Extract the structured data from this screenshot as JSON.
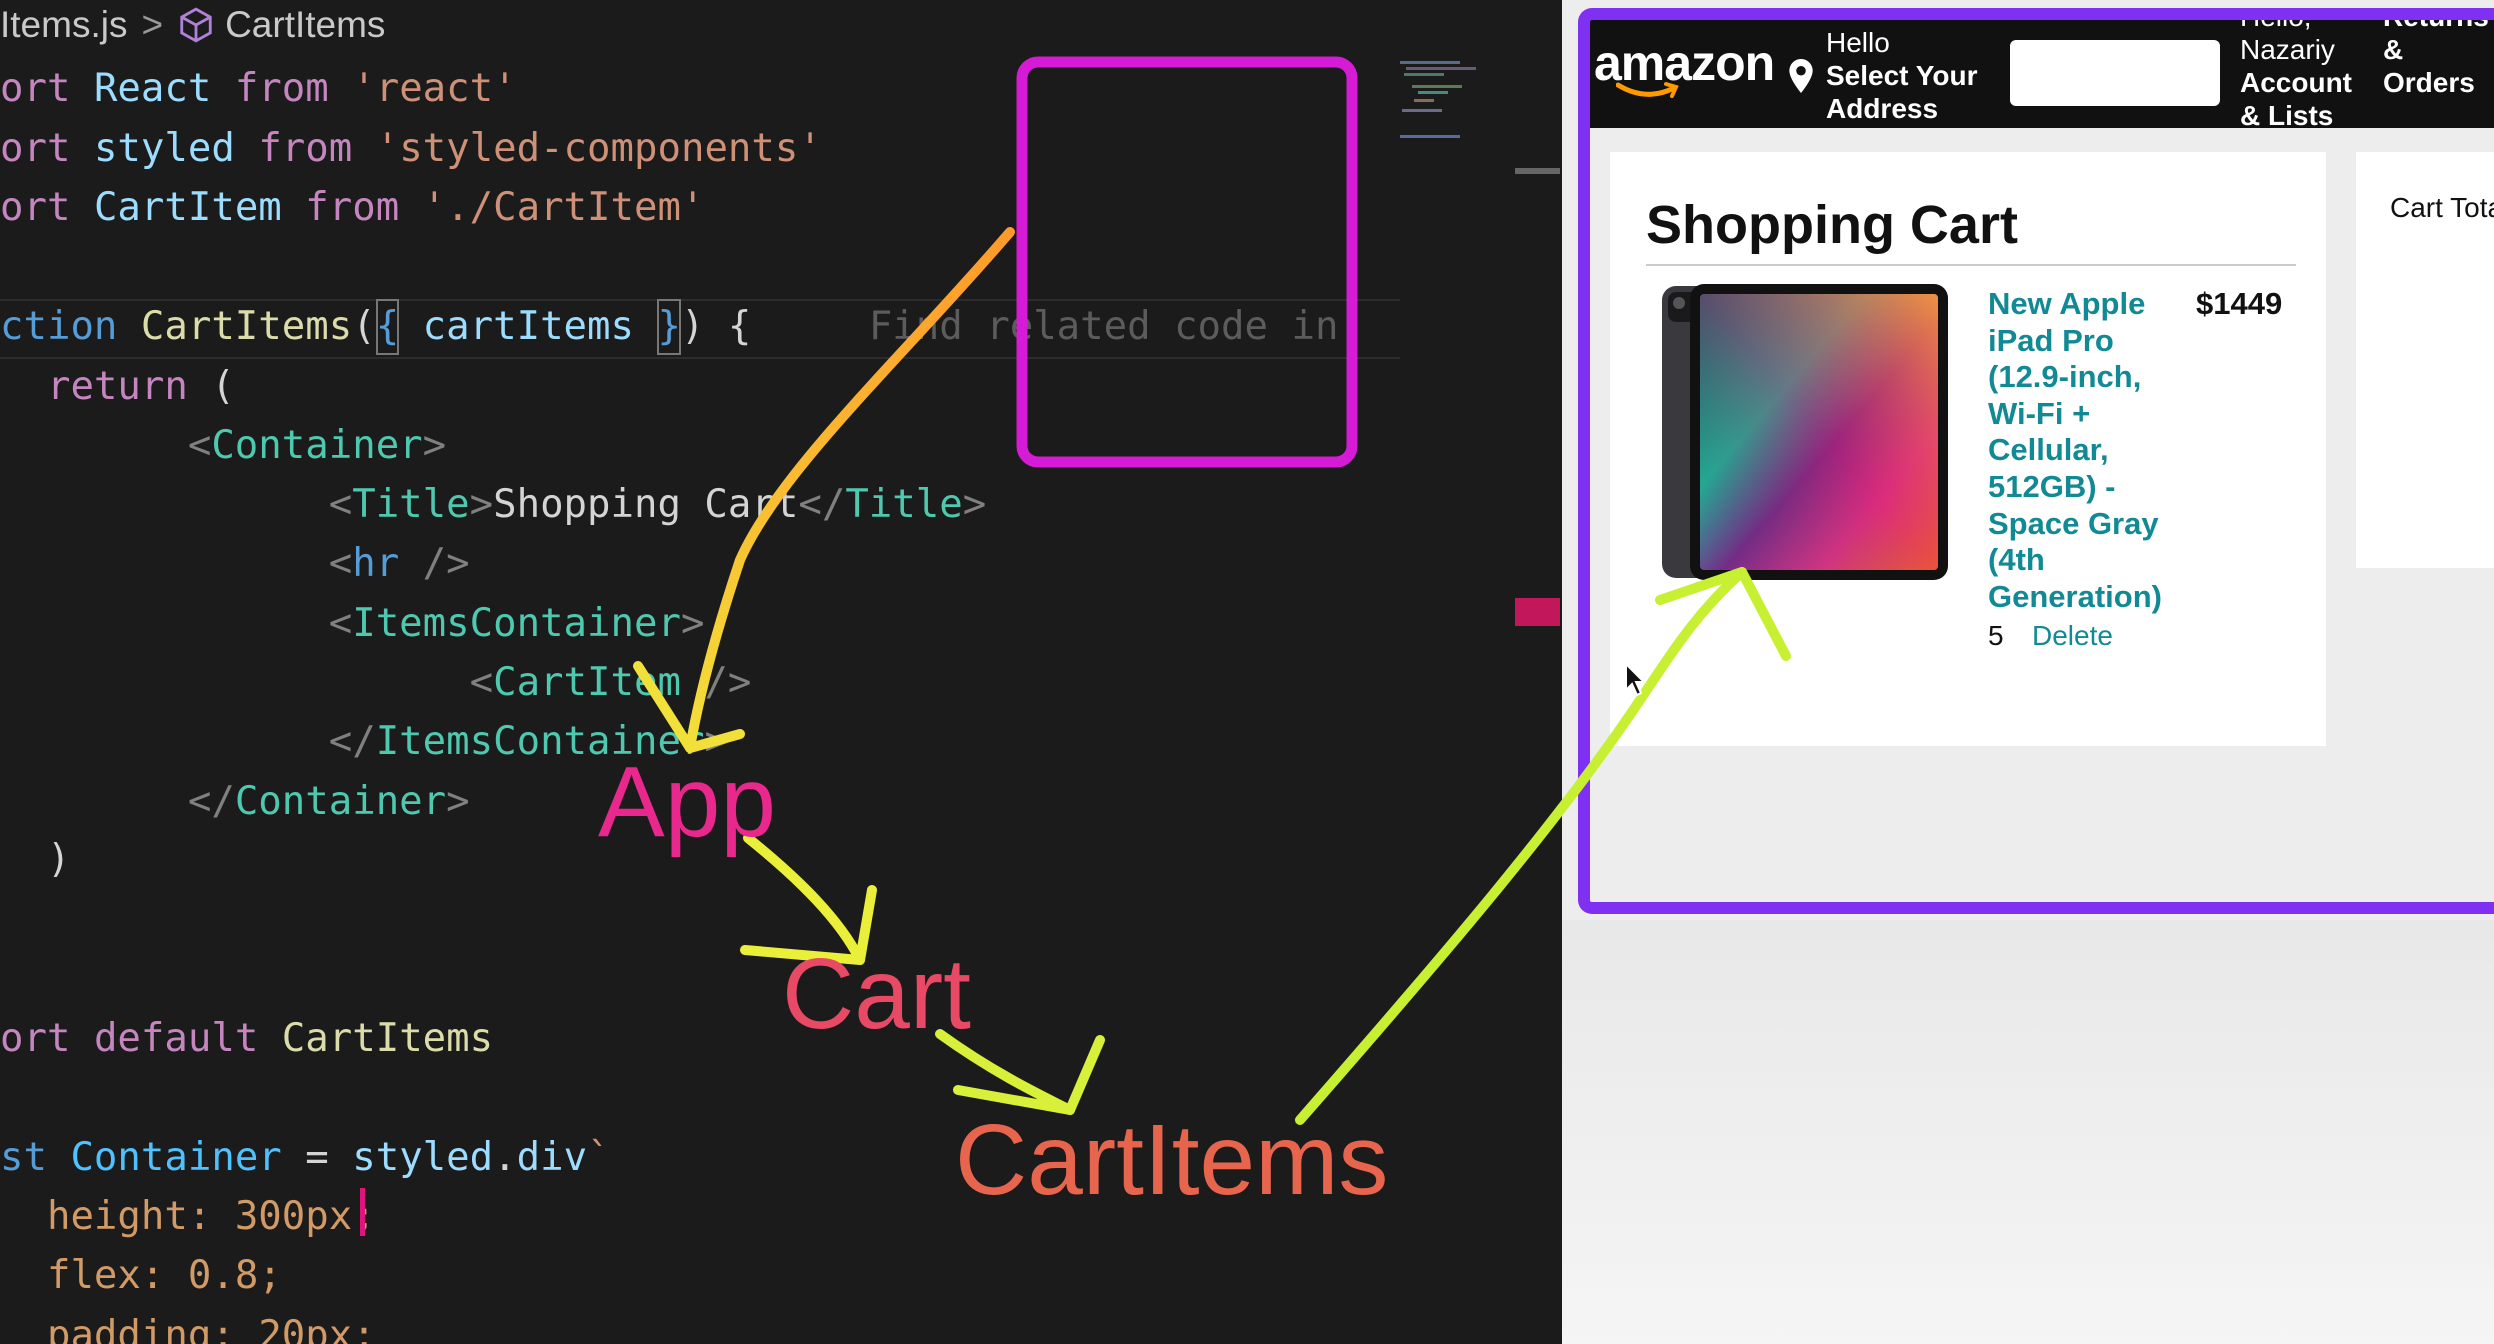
{
  "editor": {
    "breadcrumb": {
      "file": "Items.js",
      "symbol": "CartItems",
      "separator": ">"
    },
    "lines": {
      "l1": {
        "kw": "ort",
        "name": "React",
        "from": "from",
        "str": "'react'"
      },
      "l2": {
        "kw": "ort",
        "name": "styled",
        "from": "from",
        "str": "'styled-components'"
      },
      "l3": {
        "kw": "ort",
        "name": "CartItem",
        "from": "from",
        "str": "'./CartItem'"
      },
      "l5": {
        "kw": "ction",
        "name": "CartItems",
        "open": "(",
        "brace_open": "{",
        "param": "cartItems",
        "brace_close": "}",
        "close": ") {",
        "hint": "Find related code in"
      },
      "l6": {
        "kw": "return",
        "rest": "("
      },
      "l7": {
        "lt": "<",
        "tag": "Container",
        "gt": ">"
      },
      "l8": {
        "lt": "<",
        "tag": "Title",
        "gt": ">",
        "text": "Shopping Cart",
        "lt2": "</",
        "tag2": "Title",
        "gt2": ">"
      },
      "l9": {
        "lt": "<",
        "tag": "hr",
        "end": " />"
      },
      "l10": {
        "lt": "<",
        "tag": "ItemsContainer",
        "gt": ">"
      },
      "l11": {
        "lt": "<",
        "tag": "CartItem",
        "end": " />"
      },
      "l12": {
        "lt": "</",
        "tag": "ItemsContainer",
        "gt": ">"
      },
      "l13": {
        "lt": "</",
        "tag": "Container",
        "gt": ">"
      },
      "l14": {
        "text": ")"
      },
      "l17": {
        "kw": "ort",
        "mid": "default",
        "name": "CartItems"
      },
      "l19": {
        "kw": "st",
        "name": "Container",
        "eq": "=",
        "obj": "styled",
        "dot": ".",
        "prop": "div",
        "tick": "`"
      },
      "l20": {
        "prop": "height",
        "colon": ":",
        "val": "300px;"
      },
      "l21": {
        "prop": "flex",
        "colon": ":",
        "val": "0.8;"
      },
      "l22": {
        "prop": "padding",
        "colon": ":",
        "val": "20px;"
      }
    }
  },
  "annotations": {
    "app": "App",
    "cart": "Cart",
    "cart_items": "CartItems"
  },
  "browser": {
    "nav": {
      "logo": "amazon",
      "hello": "Hello",
      "select_address_1": "Select Your",
      "select_address_2": "Address",
      "search_value": "",
      "account_1": "Hello,",
      "account_2": "Nazariy",
      "account_3": "Account",
      "account_4": "& Lists",
      "orders_1": "Returns",
      "orders_2": "&",
      "orders_3": "Orders"
    },
    "cart": {
      "title": "Shopping Cart",
      "item": {
        "title": "New Apple iPad Pro (12.9-inch, Wi-Fi + Cellular, 512GB) - Space Gray (4th Generation)",
        "price": "$1449",
        "quantity": "5",
        "delete_label": "Delete"
      }
    },
    "total_label": "Cart Tota"
  },
  "colors": {
    "frame": "#7f30f2",
    "highlight_box": "#d61bd6",
    "link": "#128a96"
  }
}
